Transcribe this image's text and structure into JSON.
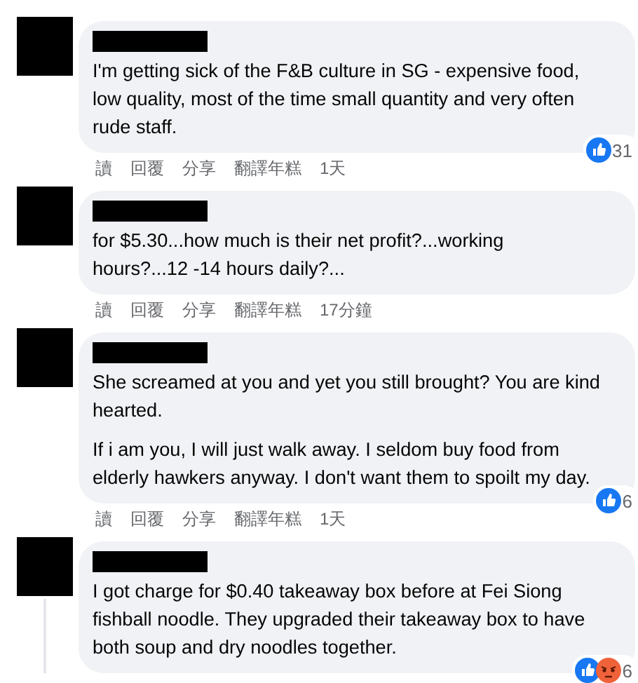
{
  "comments": [
    {
      "paragraphs": [
        "I'm getting sick of the F&B culture in SG - expensive food, low quality, most of the time small quantity and very often rude staff."
      ],
      "actions": [
        "讀",
        "回覆",
        "分享",
        "翻譯年糕"
      ],
      "time": "1天",
      "reactions": {
        "icons": [
          {
            "kind": "like"
          }
        ],
        "count": "31"
      }
    },
    {
      "paragraphs": [
        "for $5.30...how much is their net profit?...working hours?...12 -14 hours daily?..."
      ],
      "actions": [
        "讀",
        "回覆",
        "分享",
        "翻譯年糕"
      ],
      "time": "17分鐘"
    },
    {
      "paragraphs": [
        "She screamed at you and yet you still brought? You are kind hearted.",
        "If i am you, I will just walk away. I seldom buy food from elderly hawkers anyway. I don't want them to spoilt my day."
      ],
      "actions": [
        "讀",
        "回覆",
        "分享",
        "翻譯年糕"
      ],
      "time": "1天",
      "reactions": {
        "icons": [
          {
            "kind": "like"
          }
        ],
        "count": "6"
      }
    },
    {
      "paragraphs": [
        "I got charge for $0.40 takeaway box before at Fei Siong fishball noodle. They upgraded their takeaway box to have both soup and dry noodles together."
      ],
      "reactions": {
        "icons": [
          {
            "kind": "like"
          },
          {
            "kind": "angry"
          }
        ],
        "count": "6"
      },
      "thread_line": true
    }
  ]
}
